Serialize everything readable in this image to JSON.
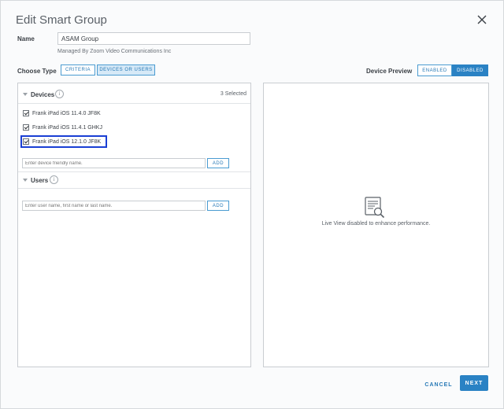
{
  "dialog": {
    "title": "Edit Smart Group"
  },
  "name_field": {
    "label": "Name",
    "value": "ASAM Group",
    "managed_by": "Managed By Zoom Video Communications Inc"
  },
  "choose_type": {
    "label": "Choose Type",
    "options": [
      "CRITERIA",
      "DEVICES OR USERS"
    ],
    "selected": "DEVICES OR USERS"
  },
  "device_preview": {
    "label": "Device Preview",
    "options": [
      "ENABLED",
      "DISABLED"
    ],
    "selected": "DISABLED"
  },
  "devices": {
    "title": "Devices",
    "count": "3 Selected",
    "items": [
      {
        "label": "Frank iPad iOS 11.4.0 JF8K",
        "checked": true
      },
      {
        "label": "Frank iPad iOS 11.4.1 GHKJ",
        "checked": true
      },
      {
        "label": "Frank iPad iOS 12.1.0 JF8K",
        "checked": true
      }
    ],
    "input_placeholder": "Enter device friendly name.",
    "add_label": "ADD"
  },
  "users": {
    "title": "Users",
    "input_placeholder": "Enter user name, first name or last name.",
    "add_label": "ADD"
  },
  "preview_panel": {
    "message": "Live View disabled to enhance performance."
  },
  "footer": {
    "cancel_label": "CANCEL",
    "next_label": "NEXT"
  },
  "colors": {
    "accent": "#2a82c4",
    "highlight": "#1a3fd4"
  }
}
